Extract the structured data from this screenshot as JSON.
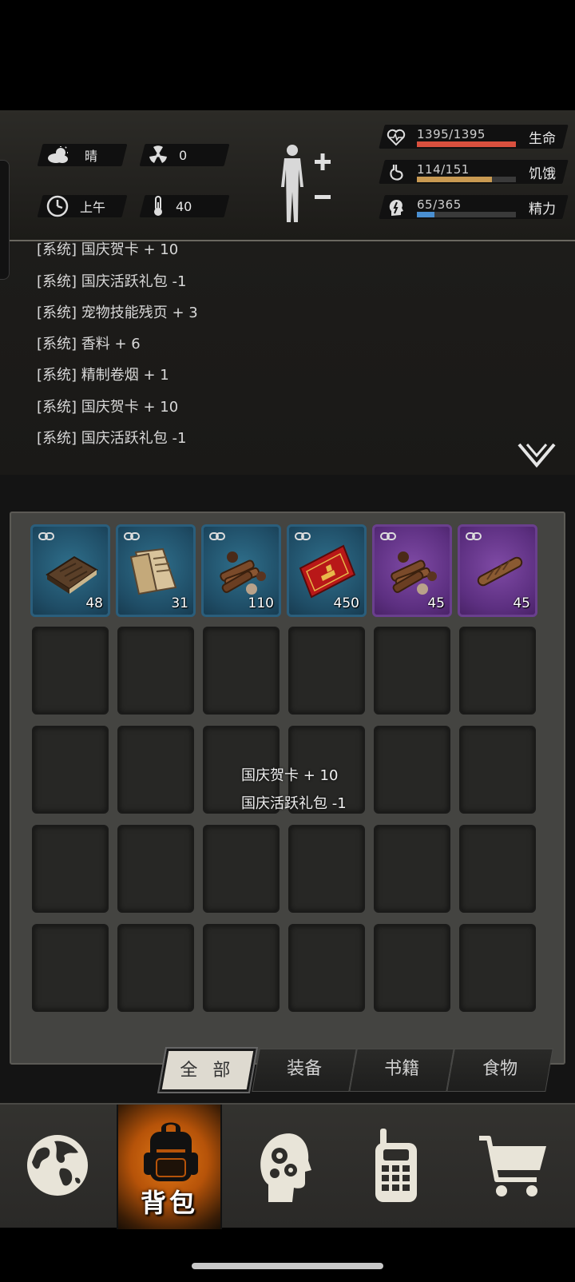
{
  "status": {
    "weather": "晴",
    "radiation": "0",
    "time_of_day": "上午",
    "temperature": "40",
    "stats": [
      {
        "label": "生命",
        "value": "1395/1395",
        "fill": 1.0,
        "color": "#d9503e",
        "icon": "heart-pulse-icon"
      },
      {
        "label": "饥饿",
        "value": "114/151",
        "fill": 0.755,
        "color": "#c99a52",
        "icon": "stomach-icon"
      },
      {
        "label": "精力",
        "value": "65/365",
        "fill": 0.178,
        "color": "#4a8fd1",
        "icon": "head-energy-icon"
      }
    ]
  },
  "log": {
    "lines": [
      "[系统] 国庆贺卡 + 10",
      "[系统] 国庆活跃礼包 -1",
      "[系统] 宠物技能残页 + 3",
      "[系统] 香料 + 6",
      "[系统] 精制卷烟 + 1",
      "[系统] 国庆贺卡 + 10",
      "[系统] 国庆活跃礼包 -1"
    ]
  },
  "inventory": {
    "items": [
      {
        "icon": "book-icon",
        "count": "48",
        "rarity": "blue"
      },
      {
        "icon": "scroll-icon",
        "count": "31",
        "rarity": "blue"
      },
      {
        "icon": "spice-bundle-icon",
        "count": "110",
        "rarity": "blue"
      },
      {
        "icon": "greeting-card-icon",
        "count": "450",
        "rarity": "blue"
      },
      {
        "icon": "spice-bundle-icon",
        "count": "45",
        "rarity": "purple"
      },
      {
        "icon": "cigarette-icon",
        "count": "45",
        "rarity": "purple"
      }
    ],
    "toast": [
      "国庆贺卡 + 10",
      "国庆活跃礼包 -1"
    ]
  },
  "tabs": [
    "全 部",
    "装备",
    "书籍",
    "食物"
  ],
  "nav": {
    "items": [
      "globe-icon",
      "backpack-icon",
      "brain-head-icon",
      "walkie-talkie-icon",
      "shopping-cart-icon"
    ],
    "active_label": "背包"
  }
}
